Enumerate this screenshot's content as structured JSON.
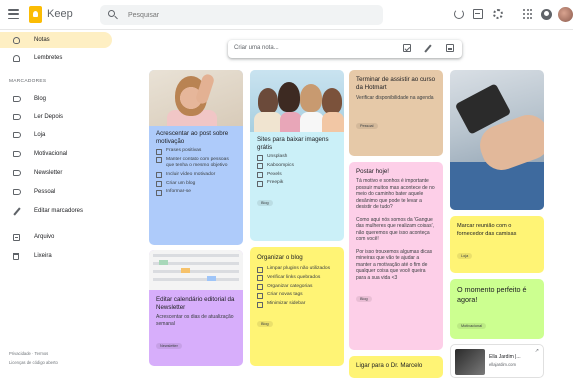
{
  "app": {
    "title": "Keep"
  },
  "search": {
    "placeholder": "Pesquisar"
  },
  "sidebar": {
    "items": [
      {
        "label": "Notas",
        "icon": "bulb-icon",
        "active": true
      },
      {
        "label": "Lembretes",
        "icon": "bell-icon"
      }
    ],
    "section_label": "MARCADORES",
    "labels": [
      "Blog",
      "Ler Depois",
      "Loja",
      "Motivacional",
      "Newsletter",
      "Pessoal",
      "Editar marcadores"
    ],
    "bottom": [
      "Arquivo",
      "Lixeira"
    ],
    "footer": [
      "Privacidade · Termos",
      "Licenças de código aberto"
    ]
  },
  "take_note": {
    "placeholder": "Criar uma nota..."
  },
  "notes": {
    "n1": {
      "title": "Acrescentar ao post sobre motivação",
      "items": [
        "Frases positivas",
        "Manter contato com pessoas que tenha o mesmo objetivo",
        "Incluir vídeo motivador",
        "Criar um blog",
        "Informar-se"
      ]
    },
    "n2": {
      "title": "Editar calendário editorial da Newsletter",
      "text": "Acrescentar os dias de atualização semanal",
      "chip": "Newsletter"
    },
    "n3": {
      "title": "Sites para baixar imagens grátis",
      "items": [
        "Unsplash",
        "Kaboompics",
        "Pexels",
        "Freepik"
      ],
      "chip": "Blog"
    },
    "n4": {
      "title": "Organizar o blog",
      "items": [
        "Limpar plugins não utilizados",
        "Verificar links quebrados",
        "Organizar categorias",
        "Criar novas tags",
        "Minimizar sidebar"
      ],
      "chip": "Blog"
    },
    "n5": {
      "title": "Terminar de assistir ao curso da Hotmart",
      "text": "Verificar disponibilidade na agenda",
      "chip": "Pessoal"
    },
    "n6": {
      "title": "Postar hoje!",
      "text1": "Tá motivo e sonhos é importante possuir muitos mas acontece de no meio do caminho bater aquele desânimo que pode te levar a desistir de tudo?",
      "text2": "Como aqui nós somos da 'Gangue das mulheres que realizam coisas', não queremos que isso aconteça com você!",
      "text3": "Por isso trouxemos algumas dicas mineiras que vão te ajudar a manter a motivação até o fim de qualquer coisa que você queira para a sua vida <3",
      "chip": "Blog"
    },
    "n7": {
      "title": "Ligar para o Dr. Marcelo"
    },
    "n8": {
      "title": "Marcar reunião com o fornecedor das camisas",
      "chip": "Loja"
    },
    "n9": {
      "title": "O momento perfeito é agora!",
      "chip": "Motivacional"
    },
    "n10": {
      "link_title": "Ella Jardim |...",
      "link_url": "ellajardim.com"
    }
  },
  "colors": {
    "blue": "#aecbfa",
    "light_blue": "#cbf0f8",
    "yellow": "#fff475",
    "orange": "#e6c9a8",
    "pink": "#fdcfe8",
    "purple": "#d7aefb",
    "green": "#ccff90",
    "active_nav": "#feefc3"
  }
}
